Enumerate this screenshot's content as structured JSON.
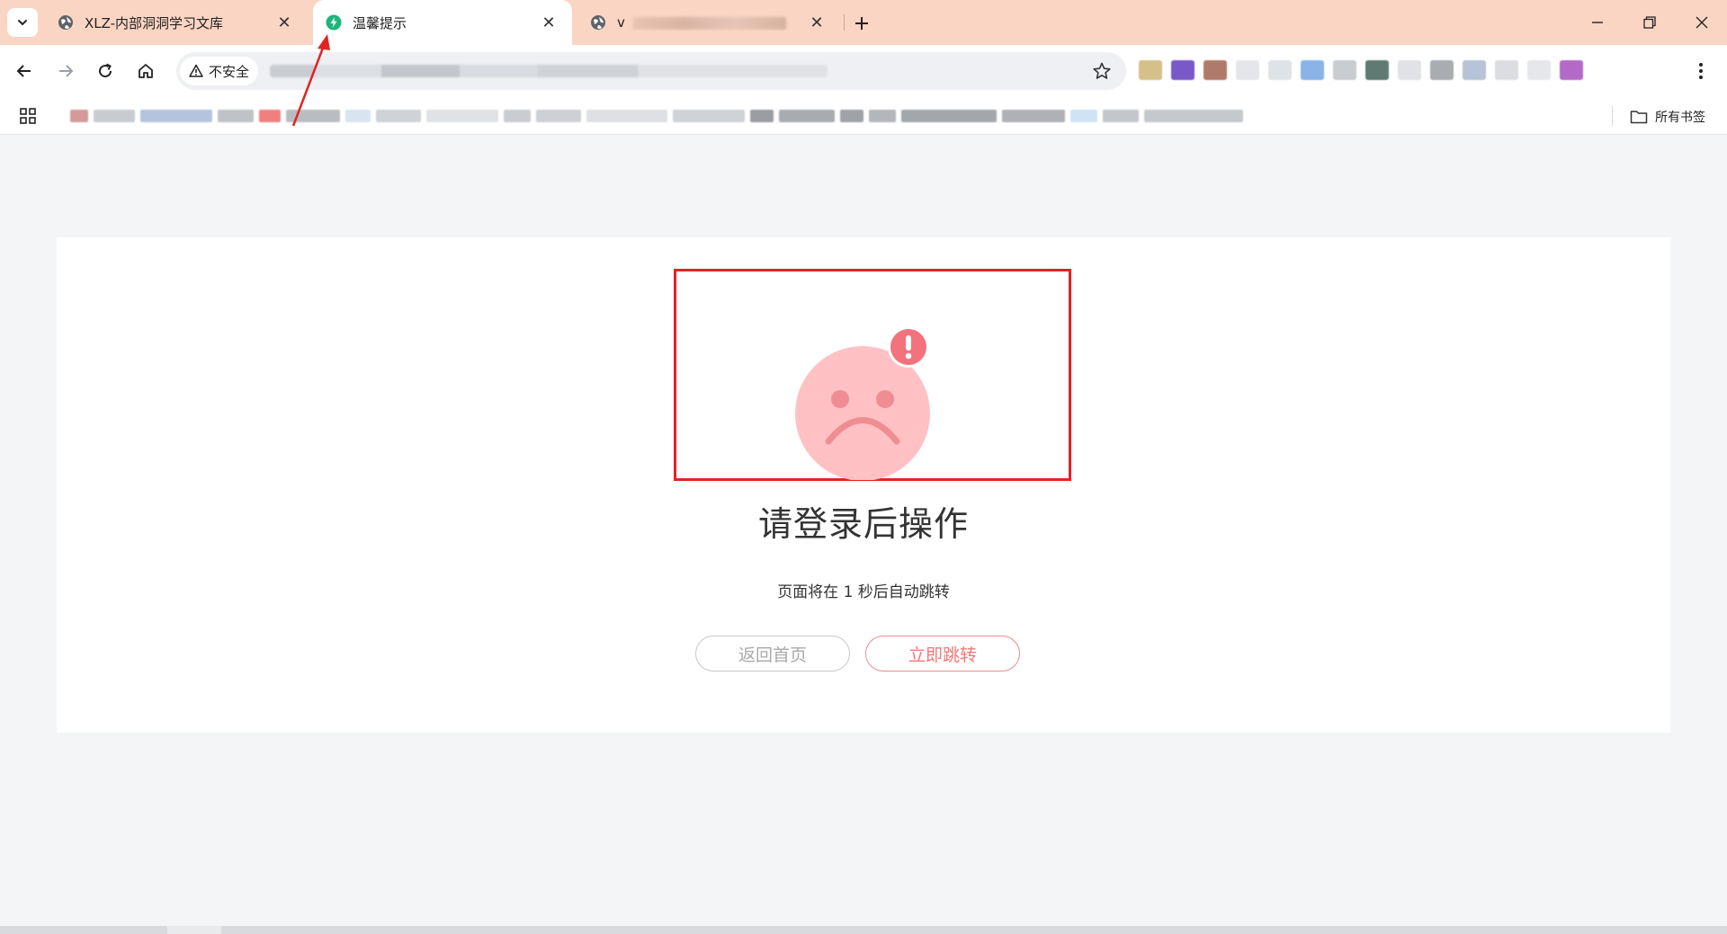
{
  "browser": {
    "tabs": [
      {
        "title": "XLZ-内部洞洞学习文库",
        "favicon": "globe-icon",
        "active": false
      },
      {
        "title": "温馨提示",
        "favicon": "bolt-icon",
        "active": true
      },
      {
        "title": "v",
        "favicon": "globe-icon",
        "active": false
      }
    ],
    "omnibox": {
      "security_label": "不安全"
    },
    "bookmarks": {
      "all_bookmarks_label": "所有书签"
    }
  },
  "page": {
    "title": "请登录后操作",
    "subtitle": "页面将在 1 秒后自动跳转",
    "buttons": {
      "home": "返回首页",
      "jump": "立即跳转"
    },
    "face_icon": "sad-face-icon",
    "badge_icon": "exclamation-icon"
  },
  "colors": {
    "tabstrip": "#fbd5c3",
    "face": "#ffc1c4",
    "face_features": "#f08d92",
    "badge": "#f2737c",
    "highlight": "#e02424",
    "jump_button": "#f27878"
  }
}
